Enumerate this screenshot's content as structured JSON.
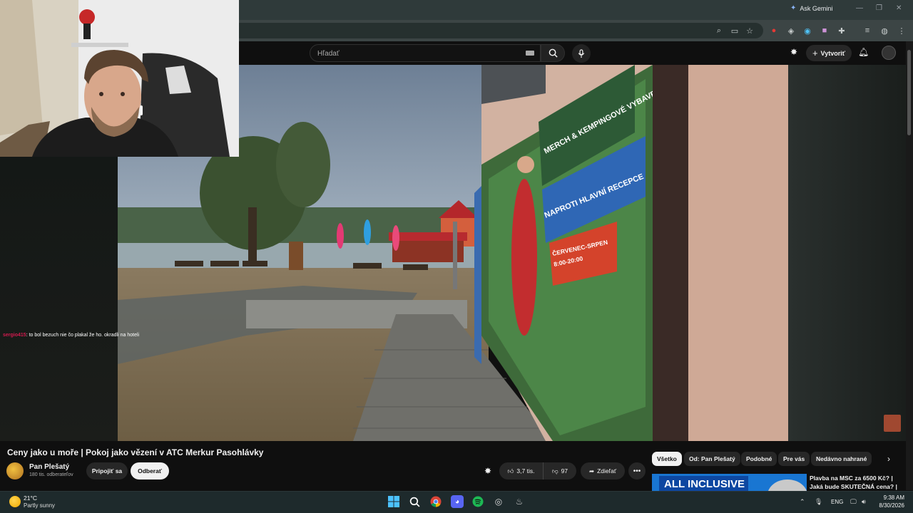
{
  "browser": {
    "ask_gemini": "Ask Gemini",
    "window_controls": [
      "—",
      "❐",
      "✕"
    ]
  },
  "header": {
    "search_placeholder": "Hľadať",
    "create_label": "Vytvoriť"
  },
  "chat": {
    "username": "sergio415",
    "message": ": to bol bezuch nie čo plakal že ho. okradli na hoteli"
  },
  "video": {
    "title": "Ceny jako u moře | Pokoj jako vězení v ATC Merkur Pasohlávky",
    "billboard": {
      "line1": "MERCH & KEMPINGOVÉ VYBAVENÍ",
      "line2": "NAPROTI HLAVNÍ RECEPCE",
      "line3": "ČERVENEC-SRPEN",
      "line4": "8:00-20:00"
    }
  },
  "owner": {
    "name": "Pan Plešatý",
    "subscribers": "180 tis. odberateľov",
    "join_label": "Pripojiť sa",
    "unsubscribe_label": "Odberať"
  },
  "actions": {
    "likes": "3,7 tis.",
    "dislikes": "97",
    "share_label": "Zdieľať"
  },
  "chips": [
    "Všetko",
    "Od: Pan Plešatý",
    "Podobné",
    "Pre vás",
    "Nedávno nahrané"
  ],
  "recommendation": {
    "thumb_text": "ALL INCLUSIVE",
    "title": "Plavba na MSC za 6500 Kč? | Jaká bude SKUTEČNÁ cena? |"
  },
  "taskbar": {
    "temperature": "21°C",
    "weather": "Partly sunny",
    "language": "ENG",
    "time": "9:38 AM",
    "date": "8/30/2026"
  }
}
